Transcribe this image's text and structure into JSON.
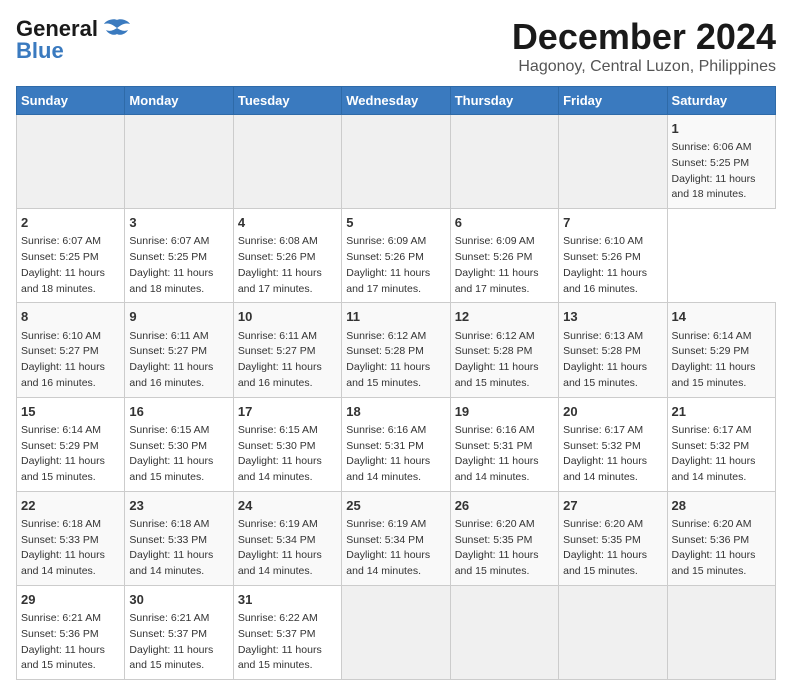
{
  "header": {
    "logo_general": "General",
    "logo_blue": "Blue",
    "main_title": "December 2024",
    "subtitle": "Hagonoy, Central Luzon, Philippines"
  },
  "calendar": {
    "headers": [
      "Sunday",
      "Monday",
      "Tuesday",
      "Wednesday",
      "Thursday",
      "Friday",
      "Saturday"
    ],
    "weeks": [
      [
        {
          "day": "",
          "empty": true
        },
        {
          "day": "",
          "empty": true
        },
        {
          "day": "",
          "empty": true
        },
        {
          "day": "",
          "empty": true
        },
        {
          "day": "",
          "empty": true
        },
        {
          "day": "",
          "empty": true
        },
        {
          "day": "1",
          "sunrise": "Sunrise: 6:06 AM",
          "sunset": "Sunset: 5:25 PM",
          "daylight": "Daylight: 11 hours and 18 minutes."
        }
      ],
      [
        {
          "day": "2",
          "sunrise": "Sunrise: 6:07 AM",
          "sunset": "Sunset: 5:25 PM",
          "daylight": "Daylight: 11 hours and 18 minutes."
        },
        {
          "day": "3",
          "sunrise": "Sunrise: 6:07 AM",
          "sunset": "Sunset: 5:25 PM",
          "daylight": "Daylight: 11 hours and 18 minutes."
        },
        {
          "day": "4",
          "sunrise": "Sunrise: 6:08 AM",
          "sunset": "Sunset: 5:26 PM",
          "daylight": "Daylight: 11 hours and 17 minutes."
        },
        {
          "day": "5",
          "sunrise": "Sunrise: 6:09 AM",
          "sunset": "Sunset: 5:26 PM",
          "daylight": "Daylight: 11 hours and 17 minutes."
        },
        {
          "day": "6",
          "sunrise": "Sunrise: 6:09 AM",
          "sunset": "Sunset: 5:26 PM",
          "daylight": "Daylight: 11 hours and 17 minutes."
        },
        {
          "day": "7",
          "sunrise": "Sunrise: 6:10 AM",
          "sunset": "Sunset: 5:26 PM",
          "daylight": "Daylight: 11 hours and 16 minutes."
        }
      ],
      [
        {
          "day": "8",
          "sunrise": "Sunrise: 6:10 AM",
          "sunset": "Sunset: 5:27 PM",
          "daylight": "Daylight: 11 hours and 16 minutes."
        },
        {
          "day": "9",
          "sunrise": "Sunrise: 6:11 AM",
          "sunset": "Sunset: 5:27 PM",
          "daylight": "Daylight: 11 hours and 16 minutes."
        },
        {
          "day": "10",
          "sunrise": "Sunrise: 6:11 AM",
          "sunset": "Sunset: 5:27 PM",
          "daylight": "Daylight: 11 hours and 16 minutes."
        },
        {
          "day": "11",
          "sunrise": "Sunrise: 6:12 AM",
          "sunset": "Sunset: 5:28 PM",
          "daylight": "Daylight: 11 hours and 15 minutes."
        },
        {
          "day": "12",
          "sunrise": "Sunrise: 6:12 AM",
          "sunset": "Sunset: 5:28 PM",
          "daylight": "Daylight: 11 hours and 15 minutes."
        },
        {
          "day": "13",
          "sunrise": "Sunrise: 6:13 AM",
          "sunset": "Sunset: 5:28 PM",
          "daylight": "Daylight: 11 hours and 15 minutes."
        },
        {
          "day": "14",
          "sunrise": "Sunrise: 6:14 AM",
          "sunset": "Sunset: 5:29 PM",
          "daylight": "Daylight: 11 hours and 15 minutes."
        }
      ],
      [
        {
          "day": "15",
          "sunrise": "Sunrise: 6:14 AM",
          "sunset": "Sunset: 5:29 PM",
          "daylight": "Daylight: 11 hours and 15 minutes."
        },
        {
          "day": "16",
          "sunrise": "Sunrise: 6:15 AM",
          "sunset": "Sunset: 5:30 PM",
          "daylight": "Daylight: 11 hours and 15 minutes."
        },
        {
          "day": "17",
          "sunrise": "Sunrise: 6:15 AM",
          "sunset": "Sunset: 5:30 PM",
          "daylight": "Daylight: 11 hours and 14 minutes."
        },
        {
          "day": "18",
          "sunrise": "Sunrise: 6:16 AM",
          "sunset": "Sunset: 5:31 PM",
          "daylight": "Daylight: 11 hours and 14 minutes."
        },
        {
          "day": "19",
          "sunrise": "Sunrise: 6:16 AM",
          "sunset": "Sunset: 5:31 PM",
          "daylight": "Daylight: 11 hours and 14 minutes."
        },
        {
          "day": "20",
          "sunrise": "Sunrise: 6:17 AM",
          "sunset": "Sunset: 5:32 PM",
          "daylight": "Daylight: 11 hours and 14 minutes."
        },
        {
          "day": "21",
          "sunrise": "Sunrise: 6:17 AM",
          "sunset": "Sunset: 5:32 PM",
          "daylight": "Daylight: 11 hours and 14 minutes."
        }
      ],
      [
        {
          "day": "22",
          "sunrise": "Sunrise: 6:18 AM",
          "sunset": "Sunset: 5:33 PM",
          "daylight": "Daylight: 11 hours and 14 minutes."
        },
        {
          "day": "23",
          "sunrise": "Sunrise: 6:18 AM",
          "sunset": "Sunset: 5:33 PM",
          "daylight": "Daylight: 11 hours and 14 minutes."
        },
        {
          "day": "24",
          "sunrise": "Sunrise: 6:19 AM",
          "sunset": "Sunset: 5:34 PM",
          "daylight": "Daylight: 11 hours and 14 minutes."
        },
        {
          "day": "25",
          "sunrise": "Sunrise: 6:19 AM",
          "sunset": "Sunset: 5:34 PM",
          "daylight": "Daylight: 11 hours and 14 minutes."
        },
        {
          "day": "26",
          "sunrise": "Sunrise: 6:20 AM",
          "sunset": "Sunset: 5:35 PM",
          "daylight": "Daylight: 11 hours and 15 minutes."
        },
        {
          "day": "27",
          "sunrise": "Sunrise: 6:20 AM",
          "sunset": "Sunset: 5:35 PM",
          "daylight": "Daylight: 11 hours and 15 minutes."
        },
        {
          "day": "28",
          "sunrise": "Sunrise: 6:20 AM",
          "sunset": "Sunset: 5:36 PM",
          "daylight": "Daylight: 11 hours and 15 minutes."
        }
      ],
      [
        {
          "day": "29",
          "sunrise": "Sunrise: 6:21 AM",
          "sunset": "Sunset: 5:36 PM",
          "daylight": "Daylight: 11 hours and 15 minutes."
        },
        {
          "day": "30",
          "sunrise": "Sunrise: 6:21 AM",
          "sunset": "Sunset: 5:37 PM",
          "daylight": "Daylight: 11 hours and 15 minutes."
        },
        {
          "day": "31",
          "sunrise": "Sunrise: 6:22 AM",
          "sunset": "Sunset: 5:37 PM",
          "daylight": "Daylight: 11 hours and 15 minutes."
        },
        {
          "day": "",
          "empty": true
        },
        {
          "day": "",
          "empty": true
        },
        {
          "day": "",
          "empty": true
        },
        {
          "day": "",
          "empty": true
        }
      ]
    ]
  }
}
